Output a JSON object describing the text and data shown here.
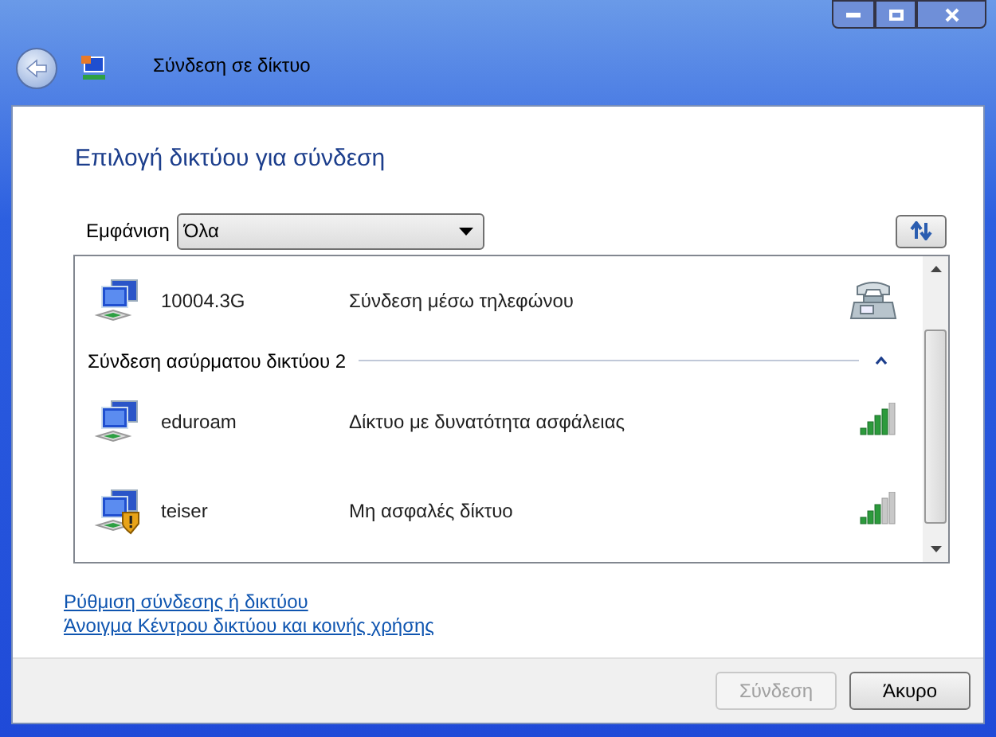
{
  "window": {
    "title": "Σύνδεση σε δίκτυο"
  },
  "heading": "Επιλογή δικτύου για σύνδεση",
  "filter": {
    "label": "Εμφάνιση",
    "value": "Όλα"
  },
  "connections": [
    {
      "name": "10004.3G",
      "kind": "dialup",
      "status": "Σύνδεση μέσω τηλεφώνου",
      "warning": false
    }
  ],
  "groups": [
    {
      "title": "Σύνδεση ασύρματου δικτύου 2",
      "expanded": true,
      "networks": [
        {
          "name": "eduroam",
          "kind": "wifi",
          "status": "Δίκτυο με δυνατότητα ασφάλειας",
          "warning": false,
          "strong_signal": true
        },
        {
          "name": "teiser",
          "kind": "wifi",
          "status": "Μη ασφαλές δίκτυο",
          "warning": true,
          "strong_signal": false
        }
      ]
    }
  ],
  "links": [
    "Ρύθμιση σύνδεσης ή δικτύου",
    "Άνοιγμα Κέντρου δικτύου και κοινής χρήσης"
  ],
  "buttons": [
    {
      "label": "Σύνδεση",
      "disabled": true
    },
    {
      "label": "Άκυρο",
      "disabled": false
    }
  ]
}
